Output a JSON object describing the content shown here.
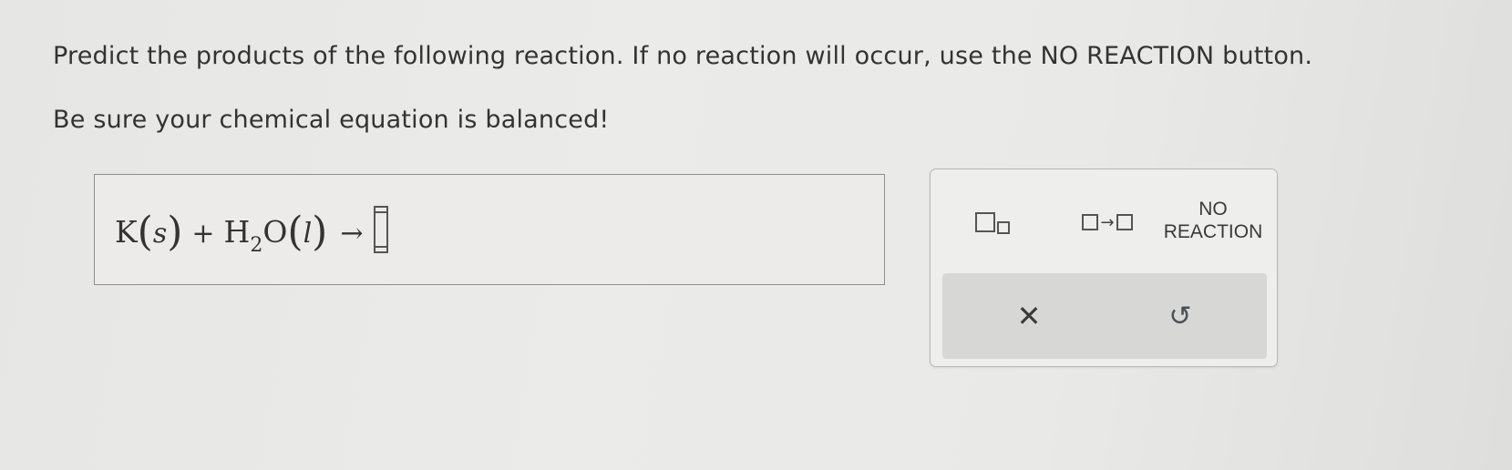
{
  "instructions": {
    "line1": "Predict the products of the following reaction. If no reaction will occur, use the NO REACTION button.",
    "line2": "Be sure your chemical equation is balanced!"
  },
  "equation": {
    "reactant1": "K",
    "reactant1_state": "s",
    "plus": "+",
    "reactant2_main": "H",
    "reactant2_sub": "2",
    "reactant2_rest": "O",
    "reactant2_state": "l",
    "arrow": "→"
  },
  "toolbar": {
    "subscript_icon": "subscript-icon",
    "arrow_icon": "reaction-arrow-icon",
    "no_reaction_line1": "NO",
    "no_reaction_line2": "REACTION",
    "clear_icon": "close-icon",
    "undo_icon": "undo-icon",
    "clear_glyph": "✕",
    "undo_glyph": "↺"
  }
}
